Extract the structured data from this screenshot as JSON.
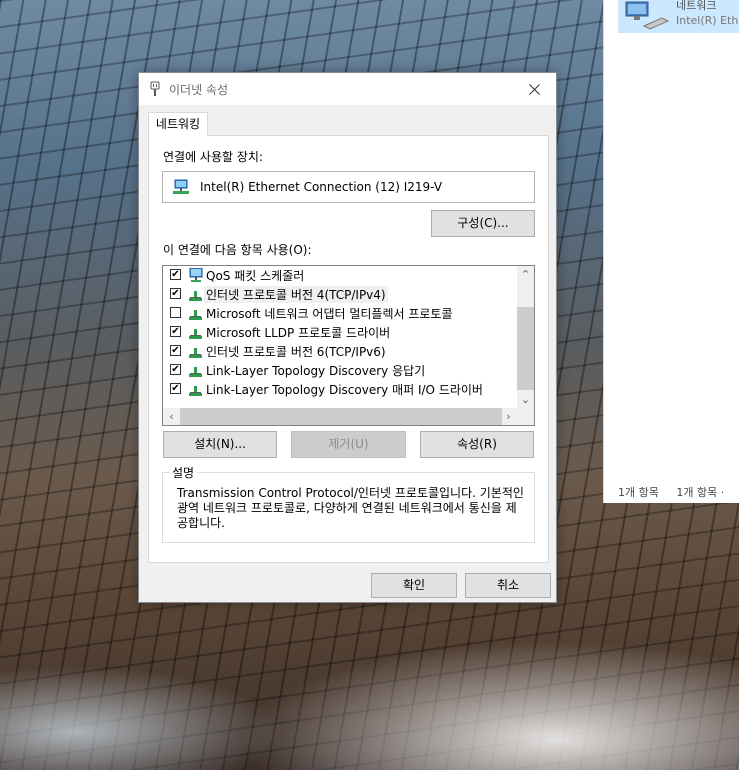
{
  "background_window": {
    "item_name": "네트워크",
    "item_subtitle": "Intel(R) Ethe",
    "status_left": "1개 항목",
    "status_right": "1개 항목 ·"
  },
  "dialog": {
    "title": "이더넷 속성",
    "tab_label": "네트워킹",
    "connect_using_label": "연결에 사용할 장치:",
    "device_name": "Intel(R) Ethernet Connection (12) I219-V",
    "configure_button": "구성(C)...",
    "items_label": "이 연결에 다음 항목 사용(O):",
    "items": [
      {
        "label": "QoS 패킷 스케줄러",
        "checked": true,
        "icon": "qos-network-icon",
        "selected": false
      },
      {
        "label": "인터넷 프로토콜 버전 4(TCP/IPv4)",
        "checked": true,
        "icon": "protocol-icon",
        "selected": true
      },
      {
        "label": "Microsoft 네트워크 어댑터 멀티플렉서 프로토콜",
        "checked": false,
        "icon": "protocol-icon",
        "selected": false
      },
      {
        "label": "Microsoft LLDP 프로토콜 드라이버",
        "checked": true,
        "icon": "protocol-icon",
        "selected": false
      },
      {
        "label": "인터넷 프로토콜 버전 6(TCP/IPv6)",
        "checked": true,
        "icon": "protocol-icon",
        "selected": false
      },
      {
        "label": "Link-Layer Topology Discovery 응답기",
        "checked": true,
        "icon": "protocol-icon",
        "selected": false
      },
      {
        "label": "Link-Layer Topology Discovery 매퍼 I/O 드라이버",
        "checked": true,
        "icon": "protocol-icon",
        "selected": false
      }
    ],
    "install_button": "설치(N)...",
    "uninstall_button": "제거(U)",
    "properties_button": "속성(R)",
    "description_title": "설명",
    "description_text": "Transmission Control Protocol/인터넷 프로토콜입니다. 기본적인 광역 네트워크 프로토콜로, 다양하게 연결된 네트워크에서 통신을 제공합니다.",
    "ok_button": "확인",
    "cancel_button": "취소"
  },
  "colors": {
    "dialog_bg": "#f0f0f0",
    "selection": "#cce8ff",
    "protocol_icon_green": "#2e9b4a"
  }
}
